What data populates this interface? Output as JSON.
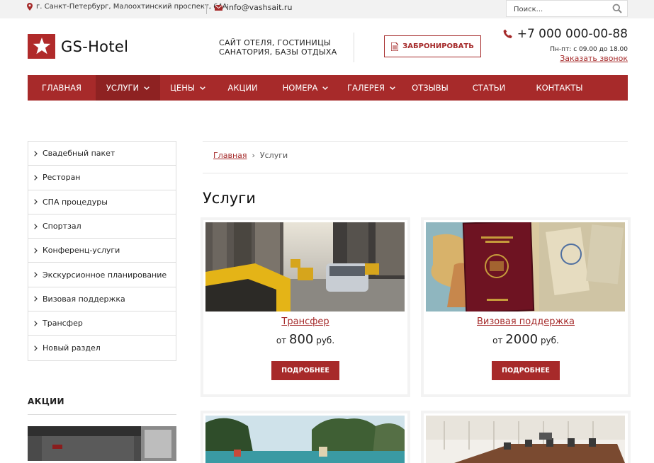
{
  "topbar": {
    "address": "г. Санкт-Петербург, Малоохтинский проспект, 64А",
    "email": "info@vashsait.ru",
    "search_placeholder": "Поиск...",
    "icons": [
      "map-pin-icon",
      "envelope-icon",
      "search-icon"
    ]
  },
  "header": {
    "logo_text": "GS-Hotel",
    "tagline_line1": "САЙТ ОТЕЛЯ, ГОСТИНИЦЫ",
    "tagline_line2": "САНАТОРИЯ, БАЗЫ ОТДЫХА",
    "book_label": "ЗАБРОНИРОВАТЬ",
    "phone": "+7 000 000-00-88",
    "hours": "Пн-пт: с 09.00 до 18.00",
    "callback_label": "Заказать звонок"
  },
  "nav": {
    "items": [
      {
        "label": "ГЛАВНАЯ",
        "dropdown": false
      },
      {
        "label": "УСЛУГИ",
        "dropdown": true,
        "active": true
      },
      {
        "label": "ЦЕНЫ",
        "dropdown": true
      },
      {
        "label": "АКЦИИ",
        "dropdown": false
      },
      {
        "label": "НОМЕРА",
        "dropdown": true
      },
      {
        "label": "ГАЛЕРЕЯ",
        "dropdown": true
      },
      {
        "label": "ОТЗЫВЫ",
        "dropdown": false
      },
      {
        "label": "СТАТЬИ",
        "dropdown": false
      },
      {
        "label": "КОНТАКТЫ",
        "dropdown": false
      }
    ]
  },
  "sidebar": {
    "items": [
      {
        "label": "Свадебный пакет"
      },
      {
        "label": "Ресторан"
      },
      {
        "label": "СПА процедуры"
      },
      {
        "label": "Спортзал"
      },
      {
        "label": "Конференц-услуги"
      },
      {
        "label": "Экскурсионное планирование"
      },
      {
        "label": "Визовая поддержка"
      },
      {
        "label": "Трансфер"
      },
      {
        "label": "Новый раздел"
      }
    ],
    "promo_title": "АКЦИИ"
  },
  "breadcrumb": {
    "home": "Главная",
    "separator": "›",
    "current": "Услуги"
  },
  "main": {
    "title": "Услуги",
    "cards": [
      {
        "title": "Трансфер",
        "price_prefix": "от",
        "price": "800",
        "price_suffix": "руб.",
        "button": "ПОДРОБНЕЕ"
      },
      {
        "title": "Визовая поддержка",
        "price_prefix": "от",
        "price": "2000",
        "price_suffix": "руб.",
        "button": "ПОДРОБНЕЕ"
      }
    ]
  },
  "colors": {
    "accent": "#a72a2a",
    "accent_dark": "#8e2222",
    "topbar_bg": "#f2f2f2"
  }
}
